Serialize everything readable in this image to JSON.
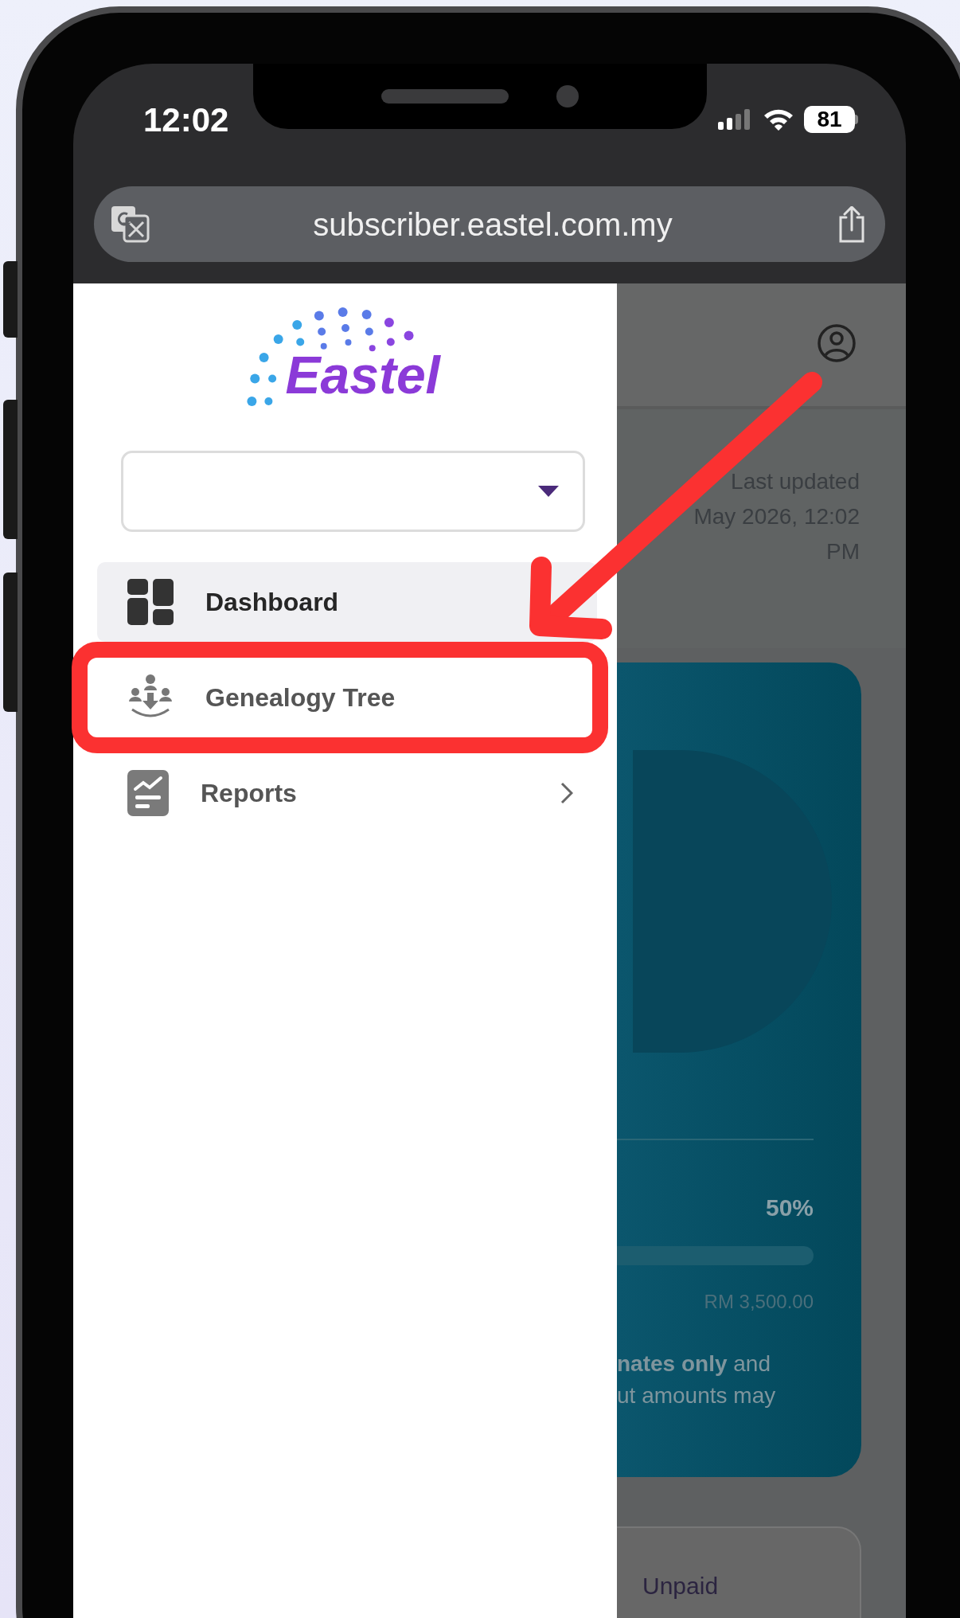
{
  "status_bar": {
    "time": "12:02",
    "battery": "81"
  },
  "browser": {
    "url": "subscriber.eastel.com.my"
  },
  "drawer": {
    "logo": "Eastel",
    "menu": [
      {
        "label": "Dashboard",
        "selected": true,
        "highlighted": false,
        "has_submenu": false
      },
      {
        "label": "Genealogy Tree",
        "selected": false,
        "highlighted": true,
        "has_submenu": false
      },
      {
        "label": "Reports",
        "selected": false,
        "highlighted": false,
        "has_submenu": true
      }
    ]
  },
  "page": {
    "last_updated": [
      "Last updated",
      "May 2026, 12:02",
      "PM"
    ],
    "card": {
      "percent": "50%",
      "amount": "RM 3,500.00",
      "note_lines": [
        "**nates only** and",
        "ut amounts may"
      ]
    },
    "unpaid_label": "Unpaid"
  }
}
